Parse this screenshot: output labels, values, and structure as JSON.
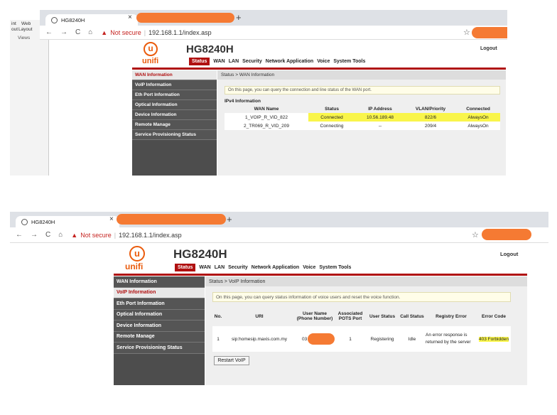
{
  "shot1": {
    "left_panel": {
      "label_1": "int",
      "label_2": "out",
      "web": "Web",
      "layout": "Layout",
      "views": "Views"
    },
    "tab_title": "HG8240H",
    "tab_close": "×",
    "new_tab": "+",
    "nav": {
      "back": "←",
      "forward": "→",
      "reload": "C",
      "home": "⌂"
    },
    "warning_icon": "▲",
    "not_secure": "Not secure",
    "separator": "|",
    "url": "192.168.1.1/index.asp",
    "star": "☆",
    "logo_letter": "u",
    "logo_text": "unifi",
    "model": "HG8240H",
    "logout": "Logout",
    "menu": [
      "Status",
      "WAN",
      "LAN",
      "Security",
      "Network Application",
      "Voice",
      "System Tools"
    ],
    "sidebar": [
      "WAN Information",
      "VoIP Information",
      "Eth Port Information",
      "Optical Information",
      "Device Information",
      "Remote Manage",
      "Service Provisioning Status"
    ],
    "breadcrumb": "Status > WAN Information",
    "info": "On this page, you can query the connection and line status of the WAN port.",
    "section_title": "IPv4 Information",
    "columns": [
      "WAN Name",
      "Status",
      "IP Address",
      "VLAN/Priority",
      "Connected"
    ],
    "rows": [
      [
        "1_VOIP_R_VID_822",
        "Connected",
        "10.56.189.48",
        "822/6",
        "AlwaysOn"
      ],
      [
        "2_TR069_R_VID_209",
        "Connecting",
        "--",
        "209/4",
        "AlwaysOn"
      ]
    ]
  },
  "shot2": {
    "tab_title": "HG8240H",
    "tab_close": "×",
    "new_tab": "+",
    "nav": {
      "back": "←",
      "forward": "→",
      "reload": "C",
      "home": "⌂"
    },
    "warning_icon": "▲",
    "not_secure": "Not secure",
    "separator": "|",
    "url": "192.168.1.1/index.asp",
    "star": "☆",
    "logo_letter": "u",
    "logo_text": "unifi",
    "model": "HG8240H",
    "logout": "Logout",
    "menu": [
      "Status",
      "WAN",
      "LAN",
      "Security",
      "Network Application",
      "Voice",
      "System Tools"
    ],
    "sidebar": [
      "WAN Information",
      "VoIP Information",
      "Eth Port Information",
      "Optical Information",
      "Device Information",
      "Remote Manage",
      "Service Provisioning Status"
    ],
    "breadcrumb": "Status > VoIP Information",
    "info": "On this page, you can query status information of voice users and reset the voice function.",
    "columns": [
      "No.",
      "URI",
      "User Name (Phone Number)",
      "Associated POTS Port",
      "User Status",
      "Call Status",
      "Registry Error",
      "Error Code"
    ],
    "row": [
      "1",
      "sip:homesip.maxis.com.my",
      "03",
      "1",
      "Registering",
      "Idle",
      "An error response is returned by the server",
      "403 Forbidden"
    ],
    "restart_button": "Restart VoIP"
  },
  "colors": {
    "accent": "#b01010",
    "logo": "#ea5b0c",
    "highlight": "#f9f54a",
    "redaction": "#f57a33"
  }
}
